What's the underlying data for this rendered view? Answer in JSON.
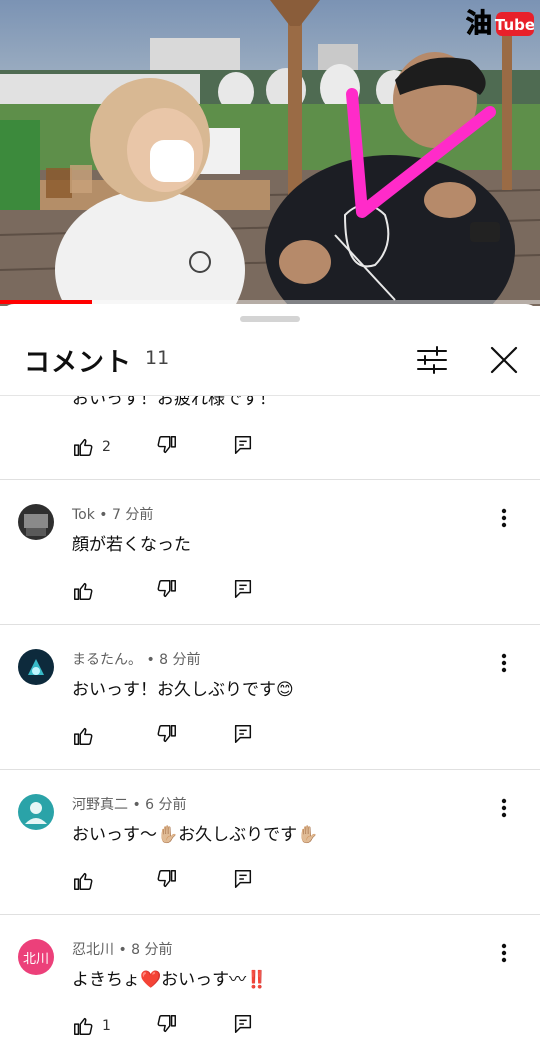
{
  "video": {
    "watermark_glyph": "油",
    "watermark_text": "Tube",
    "progress": 0.17,
    "accent": "#ff0000",
    "overlay_mark_color": "#ff2bc9"
  },
  "panel": {
    "title": "コメント",
    "count": "11",
    "filter_icon": "sliders-icon",
    "close_icon": "close-icon"
  },
  "partial_comment": {
    "text": "おいっす！お疲れ様です！",
    "like_count": "2"
  },
  "comments": [
    {
      "author": "Tok",
      "time": "7 分前",
      "text": "顔が若くなった",
      "like_count": "",
      "avatar_color": "#3b3b3b"
    },
    {
      "author": "まるたん。",
      "time": "8 分前",
      "text": "おいっす！お久しぶりです",
      "emoji": "😊",
      "like_count": "",
      "avatar_color": "#0d2a3c"
    },
    {
      "author": "河野真二",
      "time": "6 分前",
      "text": "おいっす〜",
      "emoji": "✋🏼",
      "text2": "お久しぶりです",
      "emoji2": "✋🏼",
      "like_count": "",
      "avatar_color": "#2aa3a8"
    },
    {
      "author": "忍北川",
      "time": "8 分前",
      "text": "よきちょ",
      "emoji": "❤️",
      "text2": "おいっす〰",
      "emoji2": "‼️",
      "like_count": "1",
      "avatar_label": "北川",
      "avatar_color": "#ec407a"
    }
  ]
}
